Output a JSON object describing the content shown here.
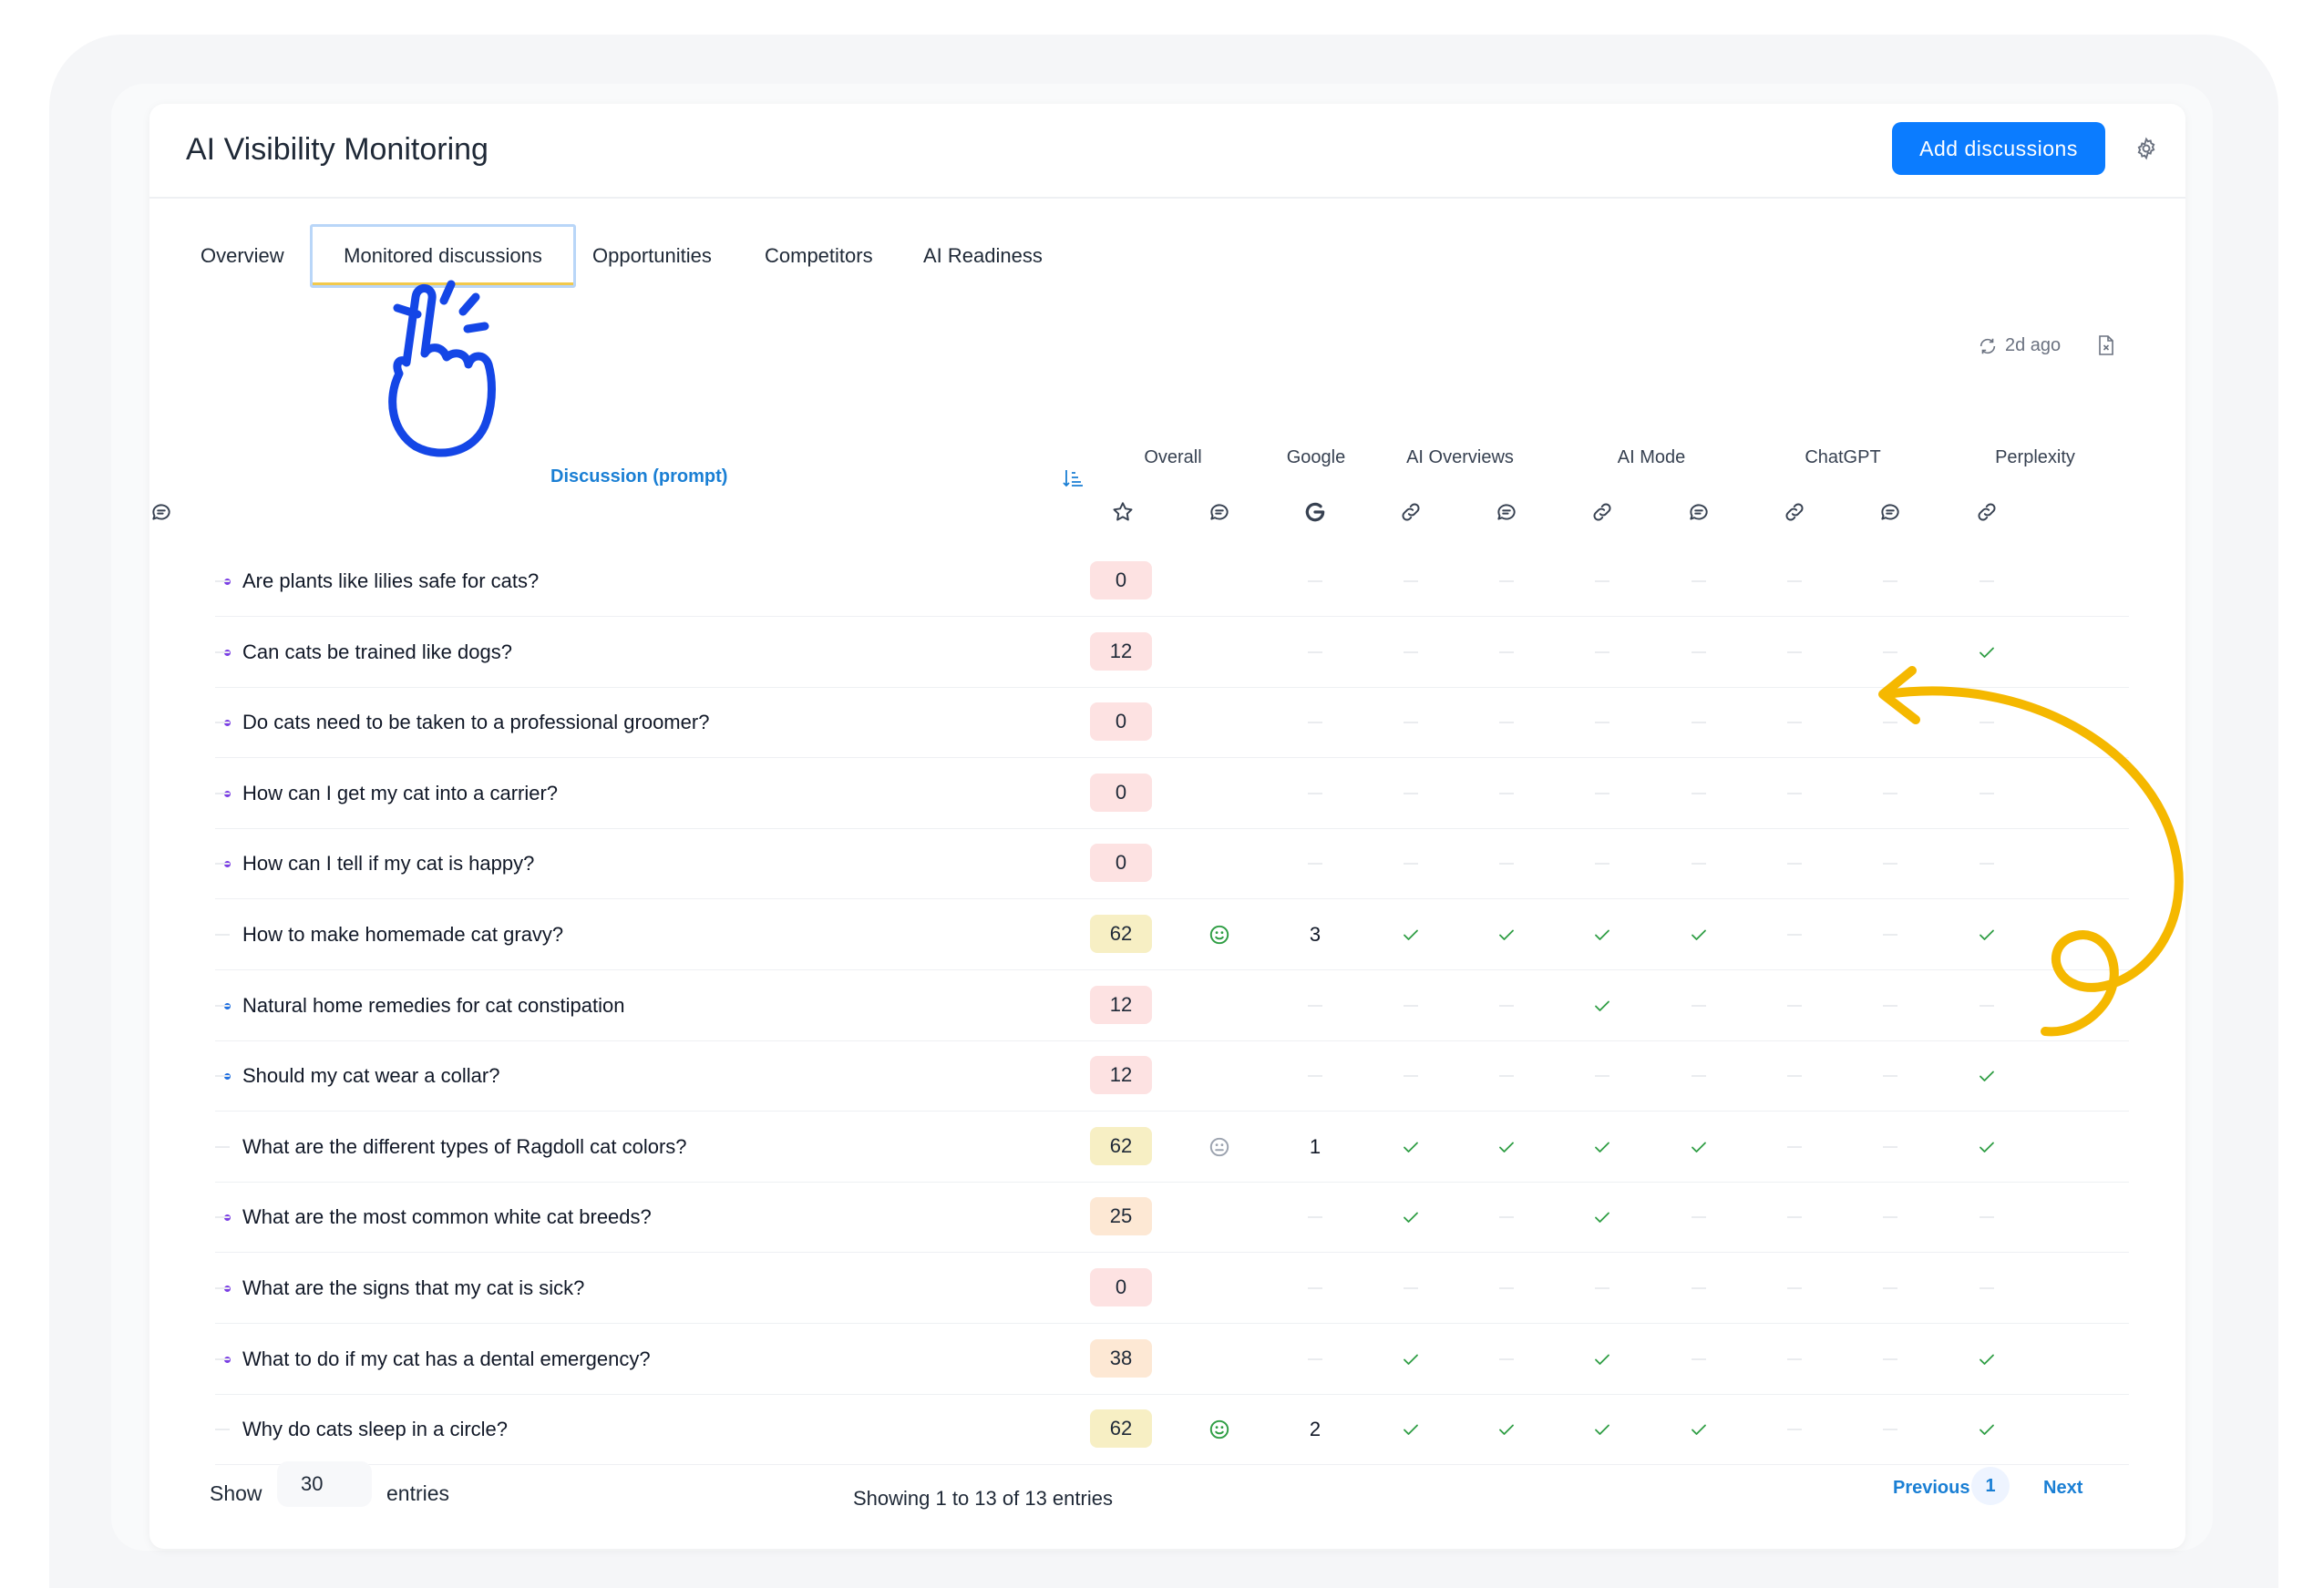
{
  "app": {
    "title": "AI Visibility Monitoring",
    "add_button": "Add discussions"
  },
  "tabs": [
    {
      "label": "Overview",
      "active": false
    },
    {
      "label": "Monitored discussions",
      "active": true
    },
    {
      "label": "Opportunities",
      "active": false
    },
    {
      "label": "Competitors",
      "active": false
    },
    {
      "label": "AI Readiness",
      "active": false
    }
  ],
  "sync": {
    "label": "2d ago",
    "icon": "refresh-icon"
  },
  "table": {
    "discussion_header": "Discussion (prompt)",
    "groups": [
      {
        "label": "Overall",
        "columns": [
          "star-icon",
          "chat-icon"
        ]
      },
      {
        "label": "Google",
        "columns": [
          "google-icon"
        ]
      },
      {
        "label": "AI Overviews",
        "columns": [
          "link-icon",
          "chat-icon"
        ]
      },
      {
        "label": "AI Mode",
        "columns": [
          "link-icon",
          "chat-icon"
        ]
      },
      {
        "label": "ChatGPT",
        "columns": [
          "link-icon",
          "chat-icon"
        ]
      },
      {
        "label": "Perplexity",
        "columns": [
          "link-icon",
          "chat-icon"
        ]
      }
    ],
    "rows": [
      {
        "prompt": "Are plants like lilies safe for cats?",
        "dot": "purple",
        "score": "0",
        "level": "low",
        "sentiment": "",
        "google": "",
        "aio_link": false,
        "aio_chat": false,
        "aim_link": false,
        "aim_chat": false,
        "gpt_link": false,
        "gpt_chat": false,
        "ppx_link": false,
        "ppx_chat": false
      },
      {
        "prompt": "Can cats be trained like dogs?",
        "dot": "purple",
        "score": "12",
        "level": "low",
        "sentiment": "",
        "google": "",
        "aio_link": false,
        "aio_chat": false,
        "aim_link": false,
        "aim_chat": false,
        "gpt_link": false,
        "gpt_chat": false,
        "ppx_link": true,
        "ppx_chat": false
      },
      {
        "prompt": "Do cats need to be taken to a professional groomer?",
        "dot": "purple",
        "score": "0",
        "level": "low",
        "sentiment": "",
        "google": "",
        "aio_link": false,
        "aio_chat": false,
        "aim_link": false,
        "aim_chat": false,
        "gpt_link": false,
        "gpt_chat": false,
        "ppx_link": false,
        "ppx_chat": false
      },
      {
        "prompt": "How can I get my cat into a carrier?",
        "dot": "purple",
        "score": "0",
        "level": "low",
        "sentiment": "",
        "google": "",
        "aio_link": false,
        "aio_chat": false,
        "aim_link": false,
        "aim_chat": false,
        "gpt_link": false,
        "gpt_chat": false,
        "ppx_link": false,
        "ppx_chat": false
      },
      {
        "prompt": "How can I tell if my cat is happy?",
        "dot": "purple",
        "score": "0",
        "level": "low",
        "sentiment": "",
        "google": "",
        "aio_link": false,
        "aio_chat": false,
        "aim_link": false,
        "aim_chat": false,
        "gpt_link": false,
        "gpt_chat": false,
        "ppx_link": false,
        "ppx_chat": false
      },
      {
        "prompt": "How to make homemade cat gravy?",
        "dot": "",
        "score": "62",
        "level": "high",
        "sentiment": "positive",
        "google": "3",
        "aio_link": true,
        "aio_chat": true,
        "aim_link": true,
        "aim_chat": true,
        "gpt_link": false,
        "gpt_chat": false,
        "ppx_link": true,
        "ppx_chat": false
      },
      {
        "prompt": "Natural home remedies for cat constipation",
        "dot": "blue",
        "score": "12",
        "level": "low",
        "sentiment": "",
        "google": "",
        "aio_link": false,
        "aio_chat": false,
        "aim_link": true,
        "aim_chat": false,
        "gpt_link": false,
        "gpt_chat": false,
        "ppx_link": false,
        "ppx_chat": false
      },
      {
        "prompt": "Should my cat wear a collar?",
        "dot": "blue",
        "score": "12",
        "level": "low",
        "sentiment": "",
        "google": "",
        "aio_link": false,
        "aio_chat": false,
        "aim_link": false,
        "aim_chat": false,
        "gpt_link": false,
        "gpt_chat": false,
        "ppx_link": true,
        "ppx_chat": false
      },
      {
        "prompt": "What are the different types of Ragdoll cat colors?",
        "dot": "",
        "score": "62",
        "level": "high",
        "sentiment": "neutral",
        "google": "1",
        "aio_link": true,
        "aio_chat": true,
        "aim_link": true,
        "aim_chat": true,
        "gpt_link": false,
        "gpt_chat": false,
        "ppx_link": true,
        "ppx_chat": false
      },
      {
        "prompt": "What are the most common white cat breeds?",
        "dot": "purple",
        "score": "25",
        "level": "mid",
        "sentiment": "",
        "google": "",
        "aio_link": true,
        "aio_chat": false,
        "aim_link": true,
        "aim_chat": false,
        "gpt_link": false,
        "gpt_chat": false,
        "ppx_link": false,
        "ppx_chat": false
      },
      {
        "prompt": "What are the signs that my cat is sick?",
        "dot": "purple",
        "score": "0",
        "level": "low",
        "sentiment": "",
        "google": "",
        "aio_link": false,
        "aio_chat": false,
        "aim_link": false,
        "aim_chat": false,
        "gpt_link": false,
        "gpt_chat": false,
        "ppx_link": false,
        "ppx_chat": false
      },
      {
        "prompt": "What to do if my cat has a dental emergency?",
        "dot": "purple",
        "score": "38",
        "level": "mid",
        "sentiment": "",
        "google": "",
        "aio_link": true,
        "aio_chat": false,
        "aim_link": true,
        "aim_chat": false,
        "gpt_link": false,
        "gpt_chat": false,
        "ppx_link": true,
        "ppx_chat": false
      },
      {
        "prompt": "Why do cats sleep in a circle?",
        "dot": "",
        "score": "62",
        "level": "high",
        "sentiment": "positive",
        "google": "2",
        "aio_link": true,
        "aio_chat": true,
        "aim_link": true,
        "aim_chat": true,
        "gpt_link": false,
        "gpt_chat": false,
        "ppx_link": true,
        "ppx_chat": false
      }
    ]
  },
  "footer": {
    "show_label": "Show",
    "entries_value": "30",
    "entries_label": "entries",
    "showing_text": "Showing 1 to 13 of 13 entries",
    "previous_label": "Previous",
    "current_page": "1",
    "next_label": "Next"
  },
  "colors": {
    "accent": "#0b7cff",
    "link": "#1a7fd4",
    "check": "#2f9e44",
    "score_low": "#fde2e2",
    "score_mid": "#fde8d4",
    "score_high": "#f7efc4",
    "dot_purple": "#7b3fe4",
    "dot_blue": "#1f6fe0",
    "annotation_hand": "#1446e6",
    "annotation_arrow": "#f5b800"
  }
}
